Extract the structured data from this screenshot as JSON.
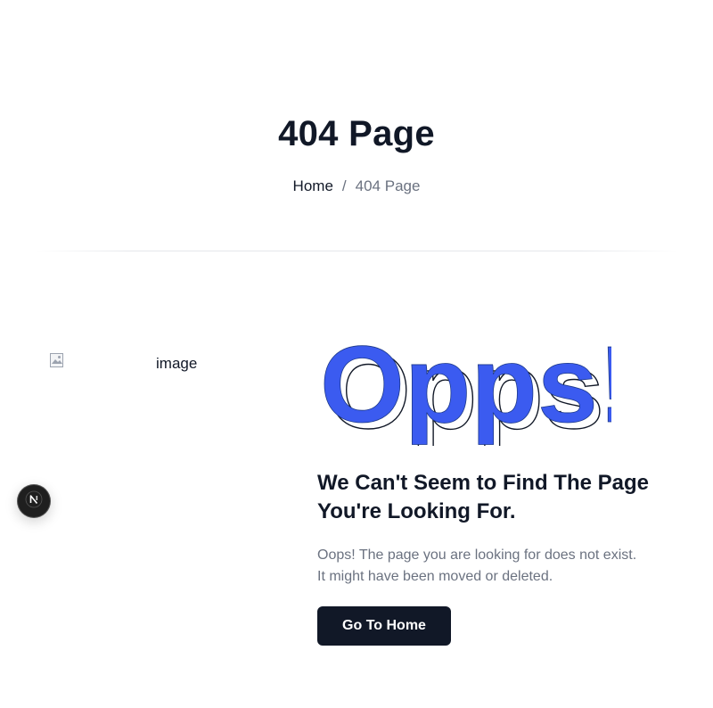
{
  "hero": {
    "title": "404 Page"
  },
  "breadcrumb": {
    "home": "Home",
    "separator": "/",
    "current": "404 Page"
  },
  "illustration": {
    "alt": "image",
    "icon": "broken-image-icon"
  },
  "error": {
    "art_text": "Opps!",
    "heading_line1": "We Can't Seem to Find The Page",
    "heading_line2": "You're Looking For.",
    "desc_line1": "Oops! The page you are looking for does not exist.",
    "desc_line2": "It might have been moved or deleted.",
    "button_label": "Go To Home"
  },
  "colors": {
    "primary_text": "#111827",
    "muted_text": "#6b7280",
    "accent_blue": "#3b5bf0",
    "button_bg": "#111827"
  },
  "badge": {
    "icon": "nextjs-logo-icon"
  }
}
